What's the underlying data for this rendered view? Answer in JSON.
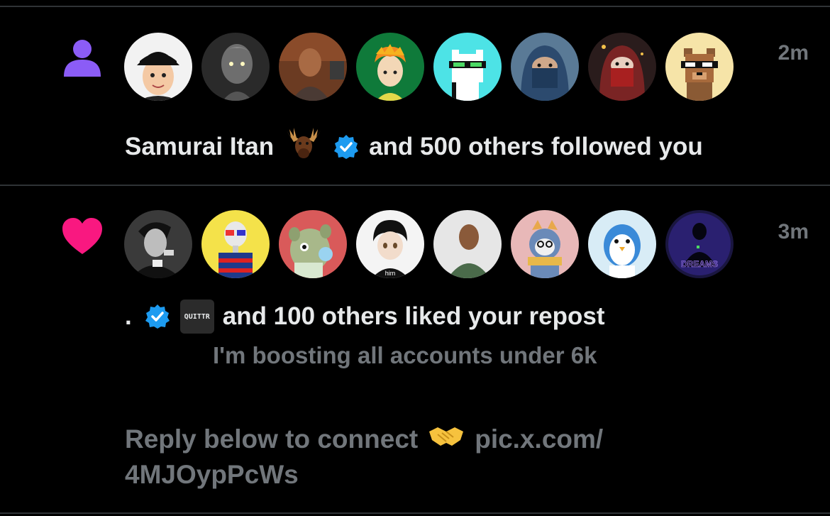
{
  "notifications": [
    {
      "type": "follow",
      "type_icon": "person-icon",
      "time": "2m",
      "actor_name": "Samurai Itan",
      "actor_emoji": "moose-emoji",
      "actor_verified": true,
      "action_text": "and 500 others followed you",
      "avatars": [
        {
          "name": "avatar-cartoon-cap-boy"
        },
        {
          "name": "avatar-stone-statue"
        },
        {
          "name": "avatar-man-at-desk"
        },
        {
          "name": "avatar-orange-hair-boy"
        },
        {
          "name": "avatar-pixel-cat-sunglasses"
        },
        {
          "name": "avatar-blue-hijab-woman"
        },
        {
          "name": "avatar-red-veil-woman"
        },
        {
          "name": "avatar-pixel-bear-sunglasses"
        }
      ]
    },
    {
      "type": "like",
      "type_icon": "heart-icon",
      "time": "3m",
      "actor_name": ".",
      "actor_verified": true,
      "actor_badge": "QUITTR",
      "action_text": "and 100 others liked your repost",
      "preview_line1": "I'm boosting all accounts under 6k",
      "preview_line2": "Reply below to connect",
      "preview_emoji": "handshake-emoji",
      "preview_link1": "pic.x.com/",
      "preview_link2": "4MJOypPcWs",
      "avatars": [
        {
          "name": "avatar-man-smoking-bw"
        },
        {
          "name": "avatar-robot-3d-glasses"
        },
        {
          "name": "avatar-bubblegum-creature"
        },
        {
          "name": "avatar-anime-boy-him",
          "label": "him"
        },
        {
          "name": "avatar-man-profile"
        },
        {
          "name": "avatar-penguin-scarf"
        },
        {
          "name": "avatar-white-penguin"
        },
        {
          "name": "avatar-dreams-silhouette",
          "label": "DREAMS"
        }
      ]
    }
  ],
  "colors": {
    "background": "#000000",
    "divider": "#2f3336",
    "primary_text": "#e7e9ea",
    "secondary_text": "#71767b",
    "follow_icon": "#8b5cf6",
    "like_icon": "#f91880",
    "verified": "#1d9bf0"
  }
}
